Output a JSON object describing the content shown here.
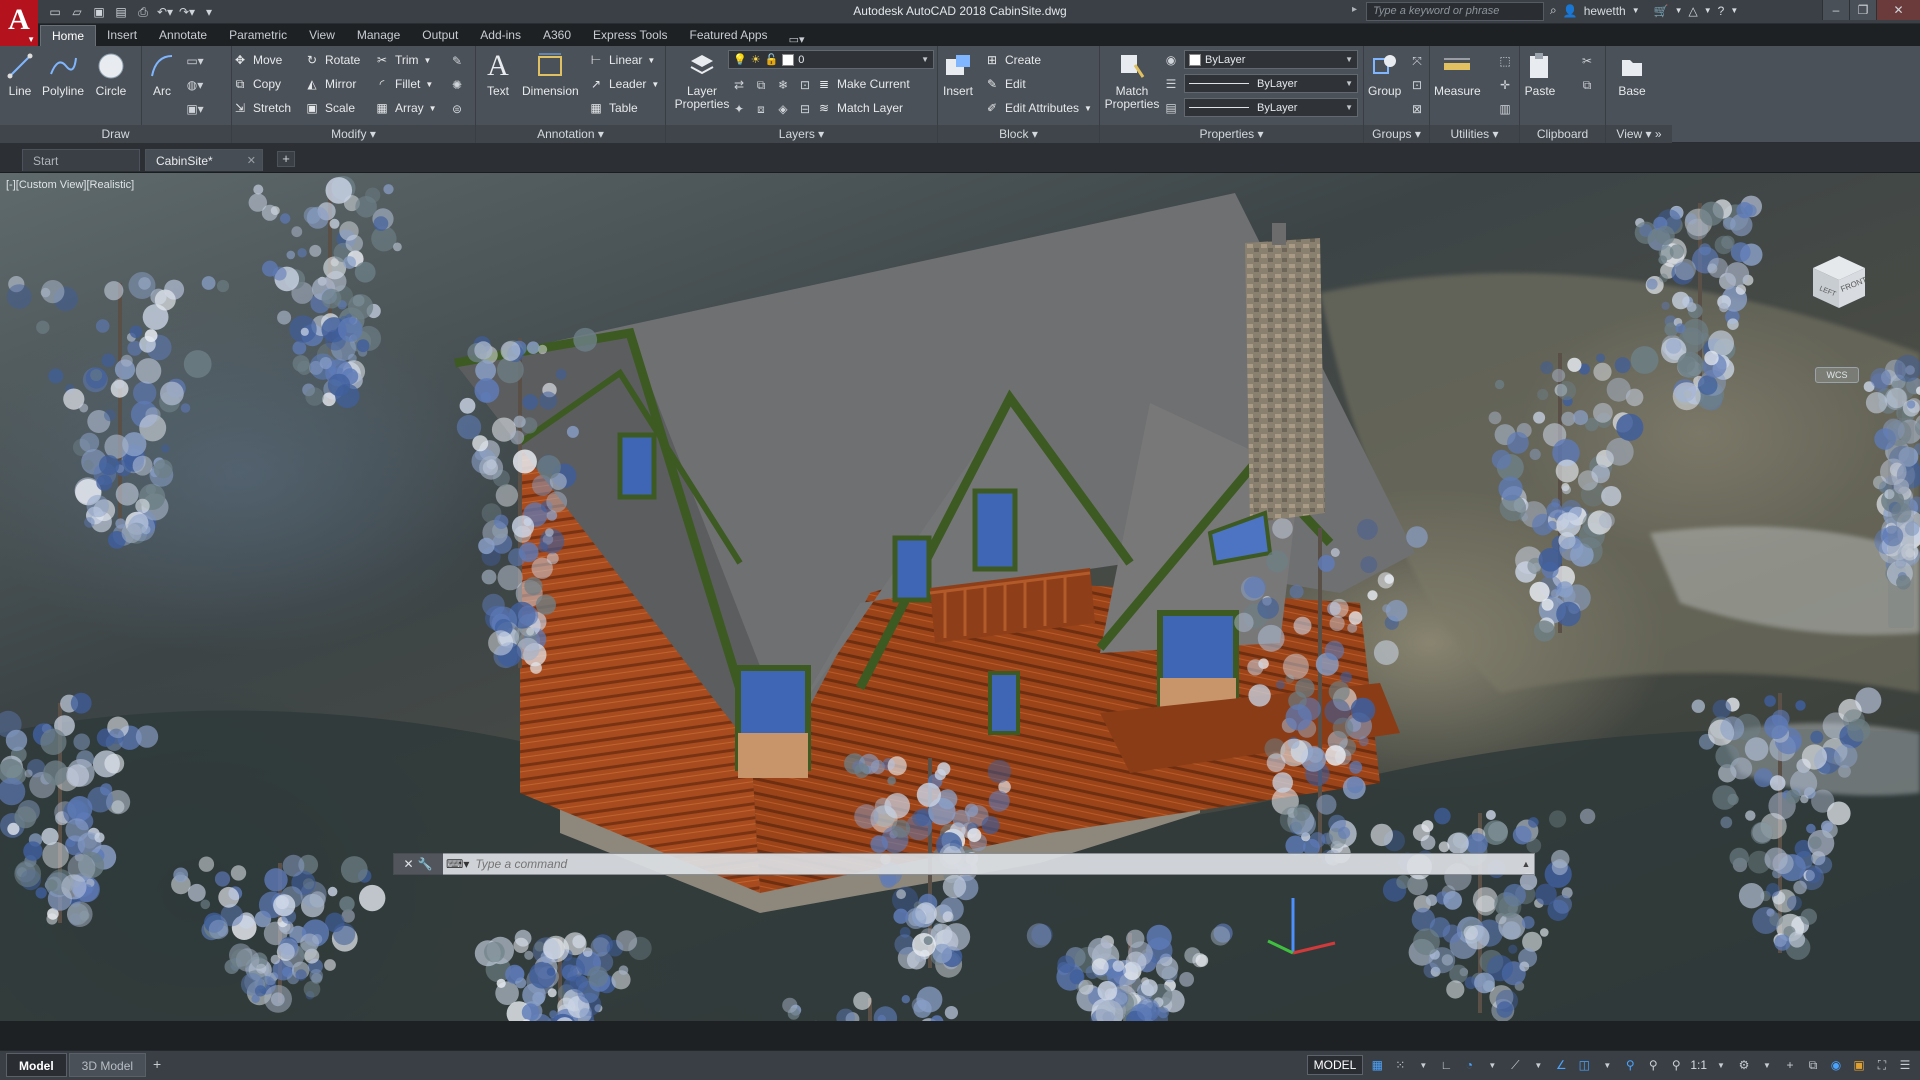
{
  "app": {
    "logo_letter": "A",
    "window_title": "Autodesk AutoCAD 2018    CabinSite.dwg",
    "search_placeholder": "Type a keyword or phrase",
    "user_name": "hewetth"
  },
  "ribbon_tabs": [
    "Home",
    "Insert",
    "Annotate",
    "Parametric",
    "View",
    "Manage",
    "Output",
    "Add-ins",
    "A360",
    "Express Tools",
    "Featured Apps"
  ],
  "panels": {
    "draw": {
      "title": "Draw",
      "tools": [
        "Line",
        "Polyline",
        "Circle",
        "Arc"
      ]
    },
    "modify": {
      "title": "Modify",
      "tools": [
        "Move",
        "Rotate",
        "Trim",
        "Copy",
        "Mirror",
        "Fillet",
        "Stretch",
        "Scale",
        "Array"
      ]
    },
    "annotation": {
      "title": "Annotation",
      "text": "Text",
      "dimension": "Dimension",
      "linear": "Linear",
      "leader": "Leader",
      "table": "Table"
    },
    "layers": {
      "title": "Layers",
      "layer_properties": "Layer\nProperties",
      "current_layer": "0",
      "make_current": "Make Current",
      "match_layer": "Match Layer"
    },
    "block": {
      "title": "Block",
      "insert": "Insert",
      "create": "Create",
      "edit": "Edit",
      "edit_attributes": "Edit Attributes"
    },
    "properties": {
      "title": "Properties",
      "match_properties": "Match\nProperties",
      "color": "ByLayer",
      "linetype": "ByLayer",
      "lineweight": "ByLayer"
    },
    "groups": {
      "title": "Groups",
      "group": "Group"
    },
    "utilities": {
      "title": "Utilities",
      "measure": "Measure"
    },
    "clipboard": {
      "title": "Clipboard",
      "paste": "Paste"
    },
    "view": {
      "title": "View",
      "base": "Base"
    }
  },
  "file_tabs": [
    {
      "label": "Start"
    },
    {
      "label": "CabinSite*"
    }
  ],
  "viewport": {
    "label": "[-][Custom View][Realistic]",
    "viewcube_left": "LEFT",
    "viewcube_front": "FRONT",
    "wcs": "WCS"
  },
  "command_line": {
    "placeholder": "Type a command"
  },
  "layout_tabs": [
    "Model",
    "3D Model"
  ],
  "status": {
    "space": "MODEL",
    "scale": "1:1"
  },
  "colors": {
    "autocad_red": "#b4121c",
    "ribbon_bg": "#4b5158",
    "log_wall": "#a44a1e",
    "roof": "#6e6f70",
    "trim_green": "#3d5a22",
    "window_blue": "#3f65b5"
  }
}
